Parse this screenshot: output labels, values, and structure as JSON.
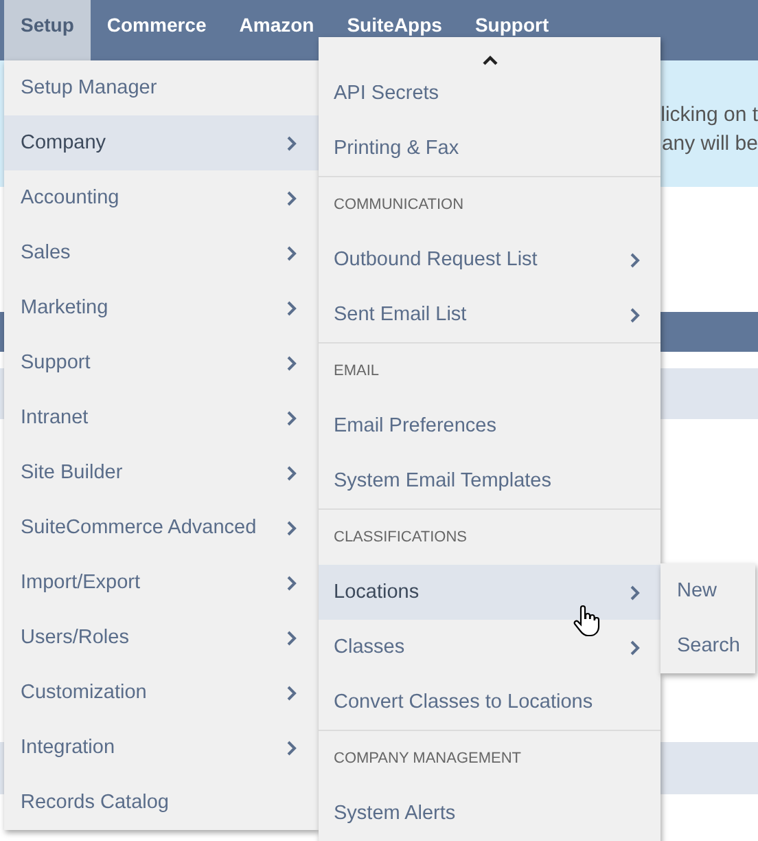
{
  "nav": {
    "tabs": [
      {
        "label": "Setup",
        "selected": true
      },
      {
        "label": "Commerce",
        "selected": false
      },
      {
        "label": "Amazon",
        "selected": false
      },
      {
        "label": "SuiteApps",
        "selected": false
      },
      {
        "label": "Support",
        "selected": false
      }
    ]
  },
  "notice": {
    "lines": [
      "licking on t",
      "any will be"
    ]
  },
  "setup_menu": {
    "items": [
      {
        "label": "Setup Manager",
        "submenu": false,
        "selected": false
      },
      {
        "label": "Company",
        "submenu": true,
        "selected": true
      },
      {
        "label": "Accounting",
        "submenu": true,
        "selected": false
      },
      {
        "label": "Sales",
        "submenu": true,
        "selected": false
      },
      {
        "label": "Marketing",
        "submenu": true,
        "selected": false
      },
      {
        "label": "Support",
        "submenu": true,
        "selected": false
      },
      {
        "label": "Intranet",
        "submenu": true,
        "selected": false
      },
      {
        "label": "Site Builder",
        "submenu": true,
        "selected": false
      },
      {
        "label": "SuiteCommerce Advanced",
        "submenu": true,
        "selected": false
      },
      {
        "label": "Import/Export",
        "submenu": true,
        "selected": false
      },
      {
        "label": "Users/Roles",
        "submenu": true,
        "selected": false
      },
      {
        "label": "Customization",
        "submenu": true,
        "selected": false
      },
      {
        "label": "Integration",
        "submenu": true,
        "selected": false
      },
      {
        "label": "Records Catalog",
        "submenu": false,
        "selected": false
      }
    ]
  },
  "company_menu": {
    "items": [
      {
        "kind": "item",
        "label": "API Secrets",
        "submenu": false,
        "selected": false
      },
      {
        "kind": "item",
        "label": "Printing & Fax",
        "submenu": false,
        "selected": false
      },
      {
        "kind": "header",
        "label": "COMMUNICATION"
      },
      {
        "kind": "item",
        "label": "Outbound Request List",
        "submenu": true,
        "selected": false
      },
      {
        "kind": "item",
        "label": "Sent Email List",
        "submenu": true,
        "selected": false
      },
      {
        "kind": "header",
        "label": "EMAIL"
      },
      {
        "kind": "item",
        "label": "Email Preferences",
        "submenu": false,
        "selected": false
      },
      {
        "kind": "item",
        "label": "System Email Templates",
        "submenu": false,
        "selected": false
      },
      {
        "kind": "header",
        "label": "CLASSIFICATIONS"
      },
      {
        "kind": "item",
        "label": "Locations",
        "submenu": true,
        "selected": true
      },
      {
        "kind": "item",
        "label": "Classes",
        "submenu": true,
        "selected": false
      },
      {
        "kind": "item",
        "label": "Convert Classes to Locations",
        "submenu": false,
        "selected": false
      },
      {
        "kind": "header",
        "label": "COMPANY MANAGEMENT"
      },
      {
        "kind": "item",
        "label": "System Alerts",
        "submenu": false,
        "selected": false
      }
    ]
  },
  "locations_menu": {
    "items": [
      {
        "label": "New"
      },
      {
        "label": "Search"
      }
    ]
  }
}
